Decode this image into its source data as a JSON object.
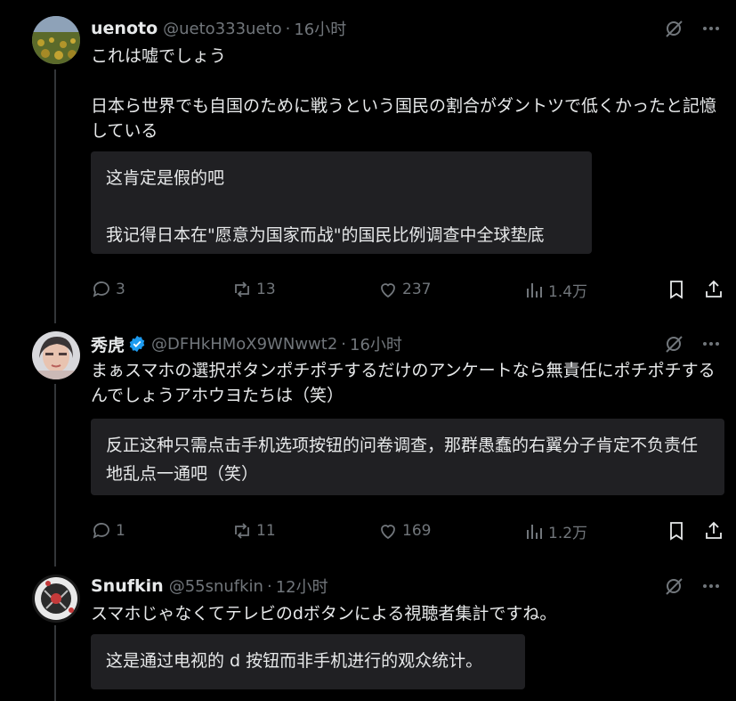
{
  "tweets": [
    {
      "name": "uenoto",
      "verified": false,
      "handle": "@ueto333ueto",
      "separator": "·",
      "time": "16小时",
      "text": "これは嘘でしょう\n\n日本ら世界でも自国のために戦うという国民の割合がダントツで低くかったと記憶している",
      "translation": "这肯定是假的吧\n\n我记得日本在\"愿意为国家而战\"的国民比例调查中全球垫底",
      "replies": "3",
      "retweets": "13",
      "likes": "237",
      "views": "1.4万"
    },
    {
      "name": "秀虎",
      "verified": true,
      "handle": "@DFHkHMoX9WNwwt2",
      "separator": "·",
      "time": "16小时",
      "text": "まぁスマホの選択ポタンポチポチするだけのアンケートなら無責任にポチポチするんでしょうアホウヨたちは（笑）",
      "translation": "反正这种只需点击手机选项按钮的问卷调查，那群愚蠢的右翼分子肯定不负责任地乱点一通吧（笑）",
      "replies": "1",
      "retweets": "11",
      "likes": "169",
      "views": "1.2万"
    },
    {
      "name": "Snufkin",
      "verified": false,
      "handle": "@55snufkin",
      "separator": "·",
      "time": "12小时",
      "text": "スマホじゃなくてテレビのdボタンによる視聴者集計ですね。",
      "translation": "这是通过电视的 d 按钮而非手机进行的观众统计。"
    }
  ],
  "colors": {
    "background": "#000000",
    "text": "#e7e9ea",
    "muted": "#71767b",
    "verified": "#1d9bf0",
    "translation_bg": "#202023"
  },
  "icons": {
    "grok": "grok-icon",
    "more": "more-icon",
    "reply": "reply-icon",
    "retweet": "retweet-icon",
    "like": "like-icon",
    "views": "views-icon",
    "bookmark": "bookmark-icon",
    "share": "share-icon"
  }
}
